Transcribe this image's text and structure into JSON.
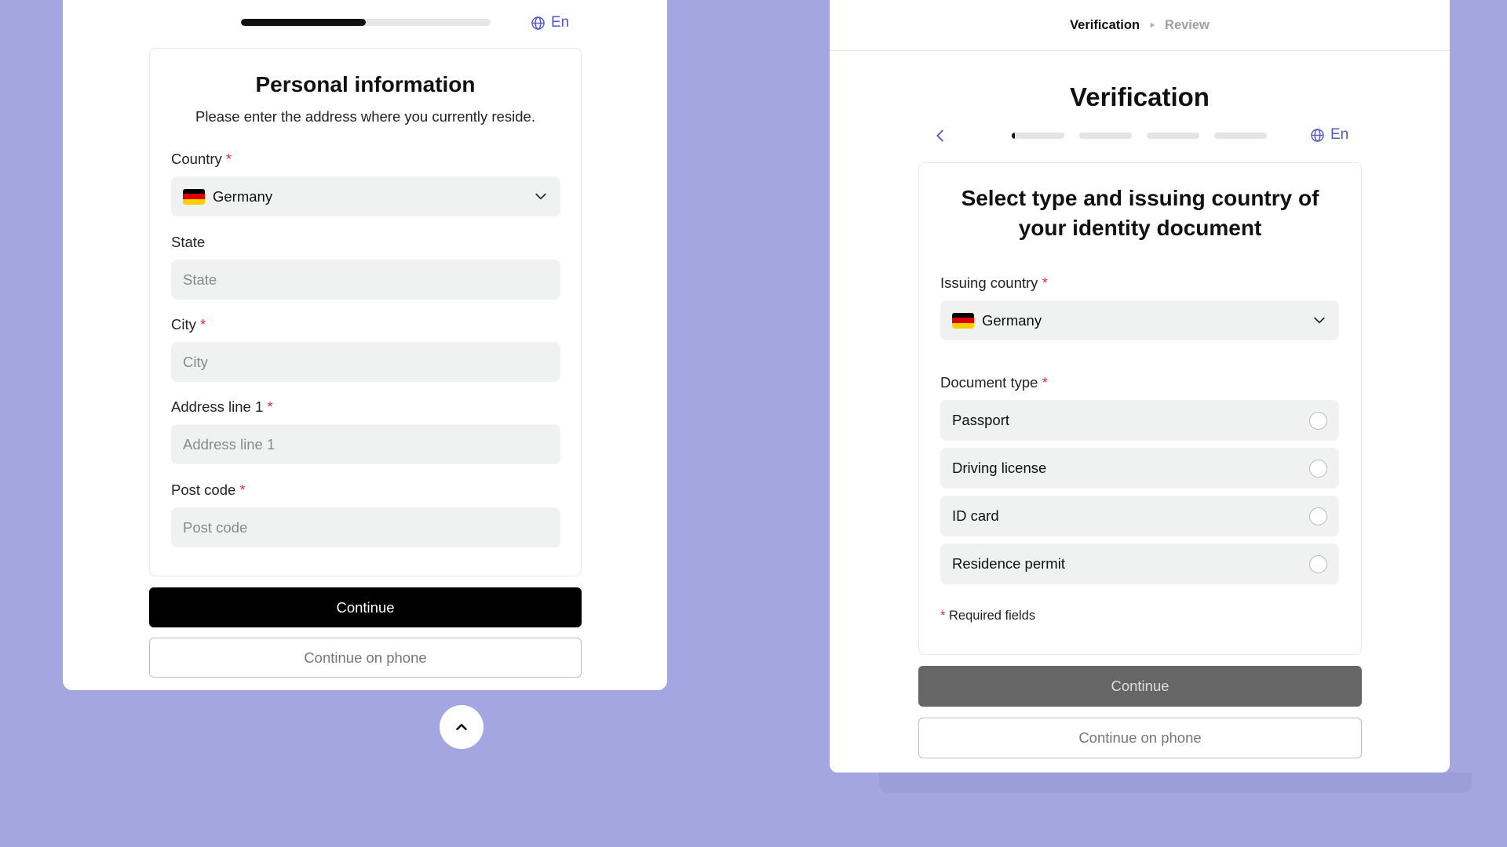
{
  "left": {
    "progress_percent": 50,
    "lang": {
      "label": "En",
      "icon": "globe-icon"
    },
    "title": "Personal information",
    "subtitle": "Please enter the address where you currently reside.",
    "fields": {
      "country": {
        "label": "Country",
        "required_mark": "*",
        "value": "Germany",
        "flag": "germany-flag-icon"
      },
      "state": {
        "label": "State",
        "placeholder": "State"
      },
      "city": {
        "label": "City",
        "required_mark": "*",
        "placeholder": "City"
      },
      "address1": {
        "label": "Address line 1",
        "required_mark": "*",
        "placeholder": "Address line 1"
      },
      "postcode": {
        "label": "Post code",
        "required_mark": "*",
        "placeholder": "Post code"
      }
    },
    "continue_label": "Continue",
    "continue_phone_label": "Continue on phone"
  },
  "right": {
    "breadcrumb": {
      "active": "Verification",
      "inactive": "Review"
    },
    "title": "Verification",
    "lang": {
      "label": "En",
      "icon": "globe-icon"
    },
    "steps": {
      "total": 4,
      "current_fill_fraction": 0.06
    },
    "card_title": "Select type and issuing country of your identity document",
    "issuing_country": {
      "label": "Issuing country",
      "required_mark": "*",
      "value": "Germany",
      "flag": "germany-flag-icon"
    },
    "document_type": {
      "label": "Document type",
      "required_mark": "*",
      "options": [
        "Passport",
        "Driving license",
        "ID card",
        "Residence permit"
      ]
    },
    "required_note": {
      "mark": "*",
      "text": "Required fields"
    },
    "continue_label": "Continue",
    "continue_phone_label": "Continue on phone"
  },
  "colors": {
    "background": "#a4a6e2",
    "accent": "#5257c9",
    "required": "#e0323c",
    "primary_button": "#000000",
    "disabled_button": "#666666"
  }
}
